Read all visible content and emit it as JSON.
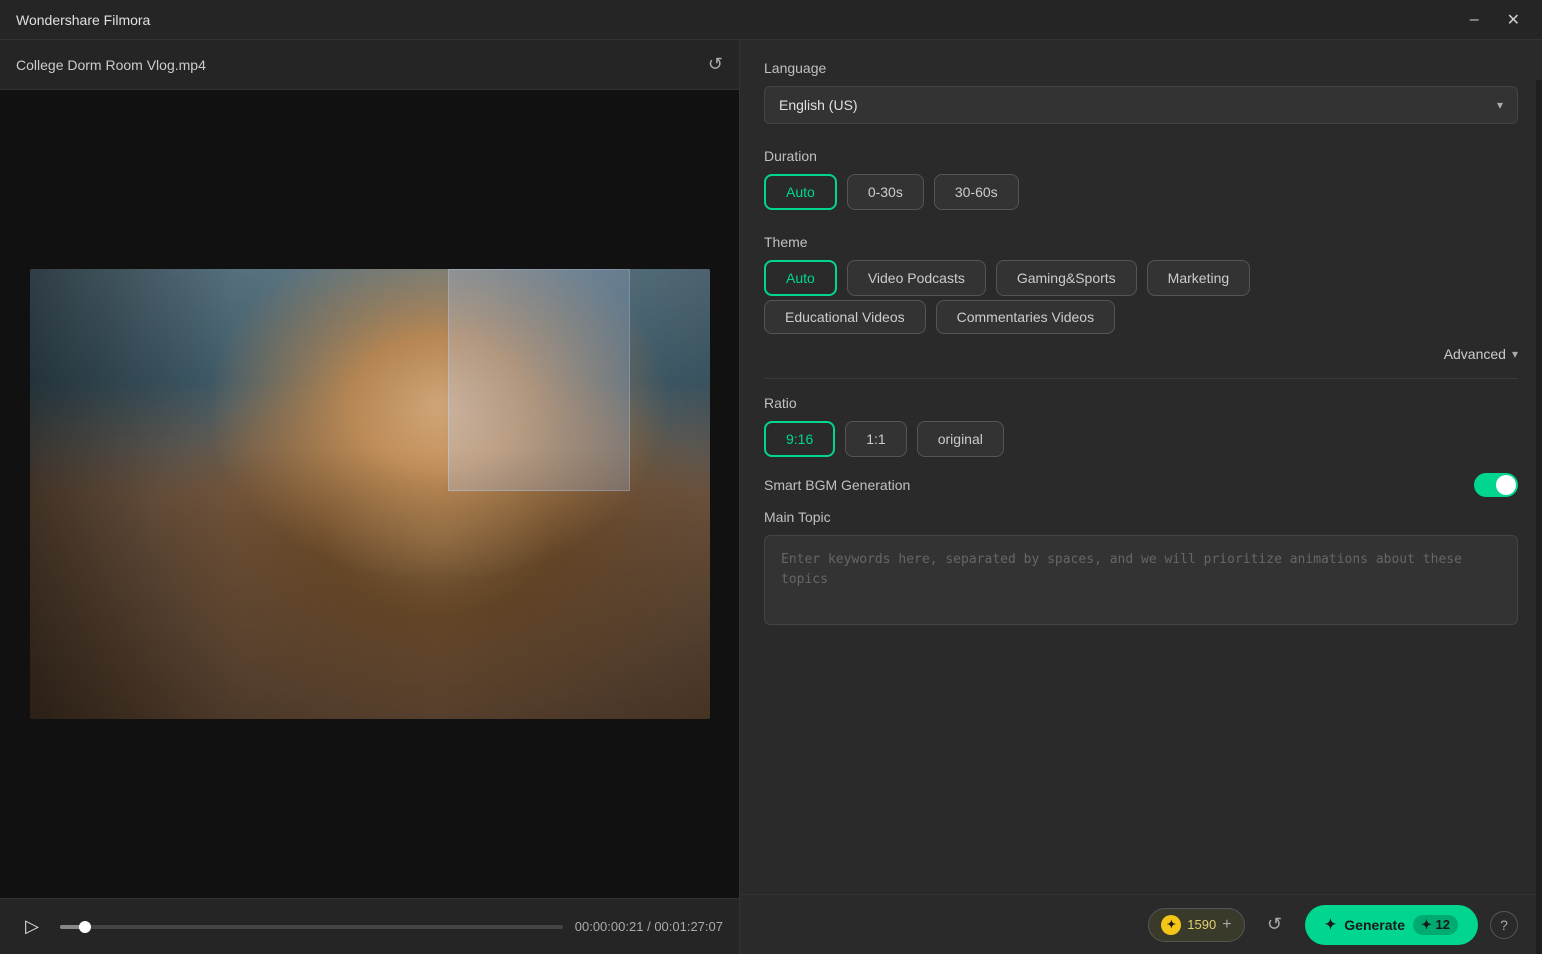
{
  "titlebar": {
    "title": "Wondershare Filmora",
    "minimize_label": "–",
    "close_label": "✕"
  },
  "file_bar": {
    "file_name": "College Dorm Room Vlog.mp4",
    "refresh_icon": "↺"
  },
  "video_controls": {
    "play_icon": "▷",
    "current_time": "00:00:00:21",
    "separator": "/",
    "total_time": "00:01:27:07"
  },
  "right_panel": {
    "language": {
      "label": "Language",
      "selected": "English (US)",
      "arrow": "▾"
    },
    "duration": {
      "label": "Duration",
      "options": [
        {
          "id": "auto",
          "label": "Auto",
          "active": true
        },
        {
          "id": "0-30s",
          "label": "0-30s",
          "active": false
        },
        {
          "id": "30-60s",
          "label": "30-60s",
          "active": false
        }
      ]
    },
    "theme": {
      "label": "Theme",
      "options": [
        {
          "id": "auto",
          "label": "Auto",
          "active": true
        },
        {
          "id": "video-podcasts",
          "label": "Video Podcasts",
          "active": false
        },
        {
          "id": "gaming-sports",
          "label": "Gaming&Sports",
          "active": false
        },
        {
          "id": "marketing",
          "label": "Marketing",
          "active": false
        },
        {
          "id": "educational",
          "label": "Educational Videos",
          "active": false
        },
        {
          "id": "commentaries",
          "label": "Commentaries Videos",
          "active": false
        }
      ]
    },
    "advanced": {
      "label": "Advanced",
      "arrow": "▾"
    },
    "ratio": {
      "label": "Ratio",
      "options": [
        {
          "id": "9-16",
          "label": "9:16",
          "active": true
        },
        {
          "id": "1-1",
          "label": "1:1",
          "active": false
        },
        {
          "id": "original",
          "label": "original",
          "active": false
        }
      ]
    },
    "smart_bgm": {
      "label": "Smart BGM Generation",
      "enabled": true
    },
    "main_topic": {
      "label": "Main Topic",
      "placeholder": "Enter keywords here, separated by spaces, and we will prioritize animations about these topics"
    }
  },
  "bottom_bar": {
    "credit_icon": "✦",
    "credit_amount": "1590",
    "plus_label": "+",
    "refresh_icon": "↺",
    "generate_label": "Generate",
    "generate_icon": "✦",
    "generate_count": "12",
    "help_icon": "?"
  },
  "colors": {
    "accent": "#00d68f",
    "accent_border": "#00d68f",
    "bg_dark": "#1e1e1e",
    "bg_panel": "#2a2a2a",
    "bg_btn": "#333333"
  }
}
